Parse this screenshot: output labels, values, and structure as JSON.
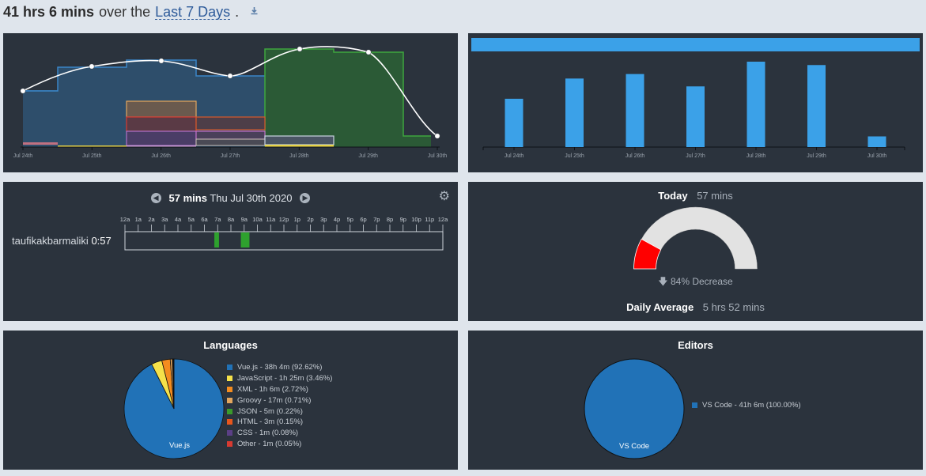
{
  "header": {
    "total": "41 hrs 6 mins",
    "over_text": "over the",
    "range": "Last 7 Days",
    "period": "."
  },
  "activity_chart": {
    "x_labels": [
      "Jul 24th",
      "Jul 25th",
      "Jul 26th",
      "Jul 27th",
      "Jul 28th",
      "Jul 29th",
      "Jul 30th"
    ]
  },
  "bar_chart": {
    "x_labels": [
      "Jul 24th",
      "Jul 25th",
      "Jul 26th",
      "Jul 27th",
      "Jul 28th",
      "Jul 29th",
      "Jul 30th"
    ]
  },
  "chart_data": {
    "type": "bar",
    "categories": [
      "Jul 24th",
      "Jul 25th",
      "Jul 26th",
      "Jul 27th",
      "Jul 28th",
      "Jul 29th",
      "Jul 30th"
    ],
    "values": [
      4.3,
      6.1,
      6.5,
      5.4,
      7.6,
      7.3,
      0.95
    ],
    "bar_color": "#3ba1e8"
  },
  "day_view": {
    "total": "57 mins",
    "date": "Thu Jul 30th 2020",
    "hours": [
      "12a",
      "1a",
      "2a",
      "3a",
      "4a",
      "5a",
      "6a",
      "7a",
      "8a",
      "9a",
      "10a",
      "11a",
      "12p",
      "1p",
      "2p",
      "3p",
      "4p",
      "5p",
      "6p",
      "7p",
      "8p",
      "9p",
      "10p",
      "11p",
      "12a"
    ],
    "user": "taufikakbarmaliki",
    "user_time": "0:57",
    "sessions": [
      {
        "start": 6.75,
        "end": 7.1
      },
      {
        "start": 8.75,
        "end": 9.4
      }
    ],
    "session_color": "#2ea12e"
  },
  "today": {
    "label": "Today",
    "value": "57 mins",
    "change": "84% Decrease",
    "gauge_fraction": 0.16,
    "gauge_color": "#ff0000",
    "avg_label": "Daily Average",
    "avg_value": "5 hrs 52 mins"
  },
  "languages": {
    "title": "Languages",
    "pie_label": "Vue.js",
    "items": [
      {
        "label": "Vue.js - 38h 4m (92.62%)",
        "percent": 92.62,
        "color": "#2172b7"
      },
      {
        "label": "JavaScript - 1h 25m (3.46%)",
        "percent": 3.46,
        "color": "#f5e14a"
      },
      {
        "label": "XML - 1h 6m (2.72%)",
        "percent": 2.72,
        "color": "#f48c1f"
      },
      {
        "label": "Groovy - 17m (0.71%)",
        "percent": 0.71,
        "color": "#e3a65e"
      },
      {
        "label": "JSON - 5m (0.22%)",
        "percent": 0.22,
        "color": "#3a9a2b"
      },
      {
        "label": "HTML - 3m (0.15%)",
        "percent": 0.15,
        "color": "#e8561c"
      },
      {
        "label": "CSS - 1m (0.08%)",
        "percent": 0.08,
        "color": "#5b3f86"
      },
      {
        "label": "Other - 1m (0.05%)",
        "percent": 0.05,
        "color": "#d73a31"
      }
    ]
  },
  "editors": {
    "title": "Editors",
    "pie_label": "VS Code",
    "items": [
      {
        "label": "VS Code - 41h 6m (100.00%)",
        "percent": 100,
        "color": "#2172b7"
      }
    ]
  }
}
